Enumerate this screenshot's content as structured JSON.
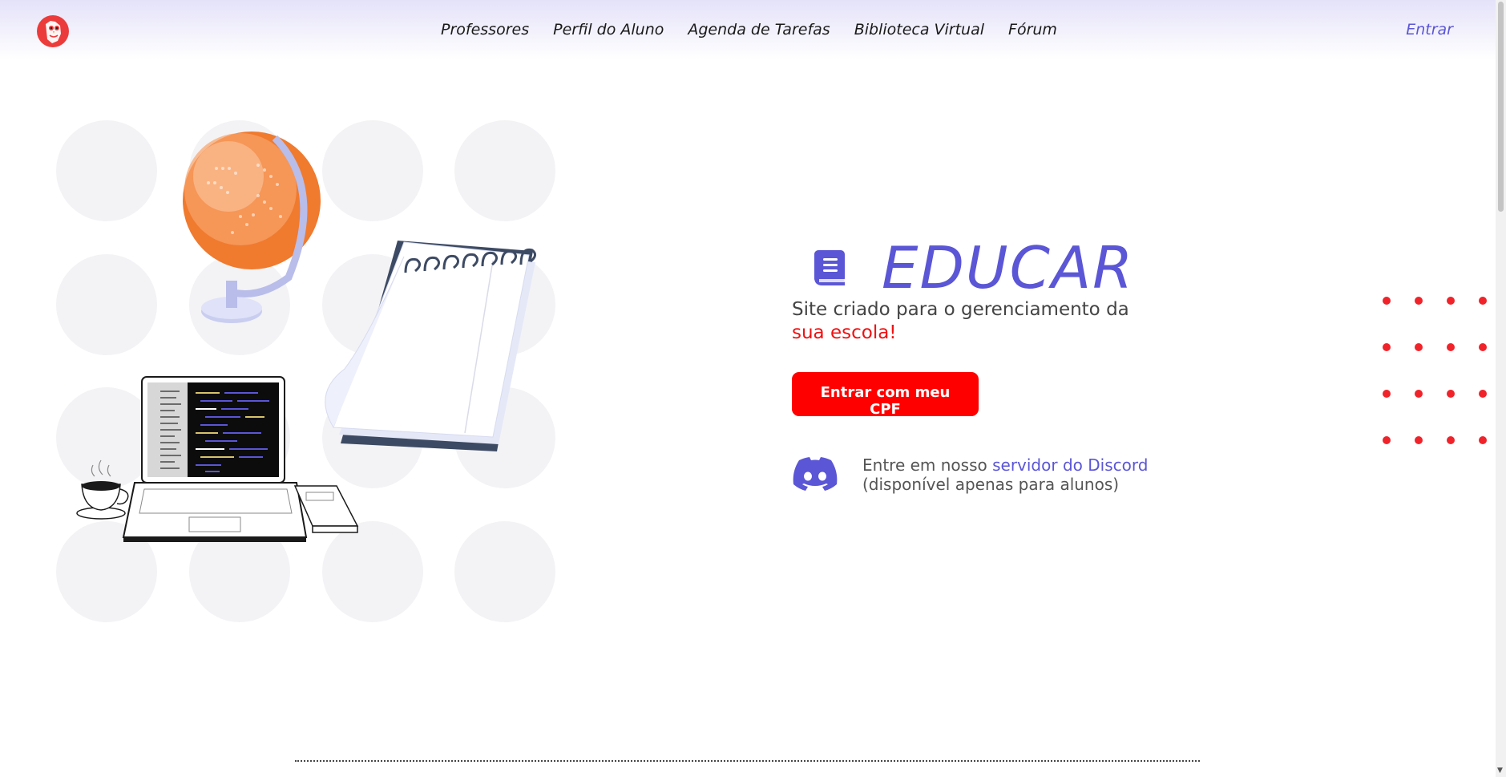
{
  "header": {
    "logo_name": "owl-logo",
    "nav": [
      {
        "label": "Professores"
      },
      {
        "label": "Perfil do Aluno"
      },
      {
        "label": "Agenda de Tarefas"
      },
      {
        "label": "Biblioteca Virtual"
      },
      {
        "label": "Fórum"
      }
    ],
    "login_label": "Entrar"
  },
  "hero": {
    "brand": "EDUCAR",
    "tagline": "Site criado para o gerenciamento da",
    "tagline_accent": "sua escola!",
    "cta_label": "Entrar com meu CPF",
    "discord_prefix": "Entre em nosso ",
    "discord_link": "servidor do Discord",
    "discord_note": "(disponível apenas para alunos)"
  },
  "colors": {
    "accent": "#5b56d6",
    "cta": "#ff0000",
    "highlight": "#ef1111"
  },
  "icons": [
    "owl-logo-icon",
    "book-icon",
    "discord-icon",
    "globe-icon",
    "laptop-icon",
    "notebook-icon",
    "coffee-cup-icon"
  ]
}
